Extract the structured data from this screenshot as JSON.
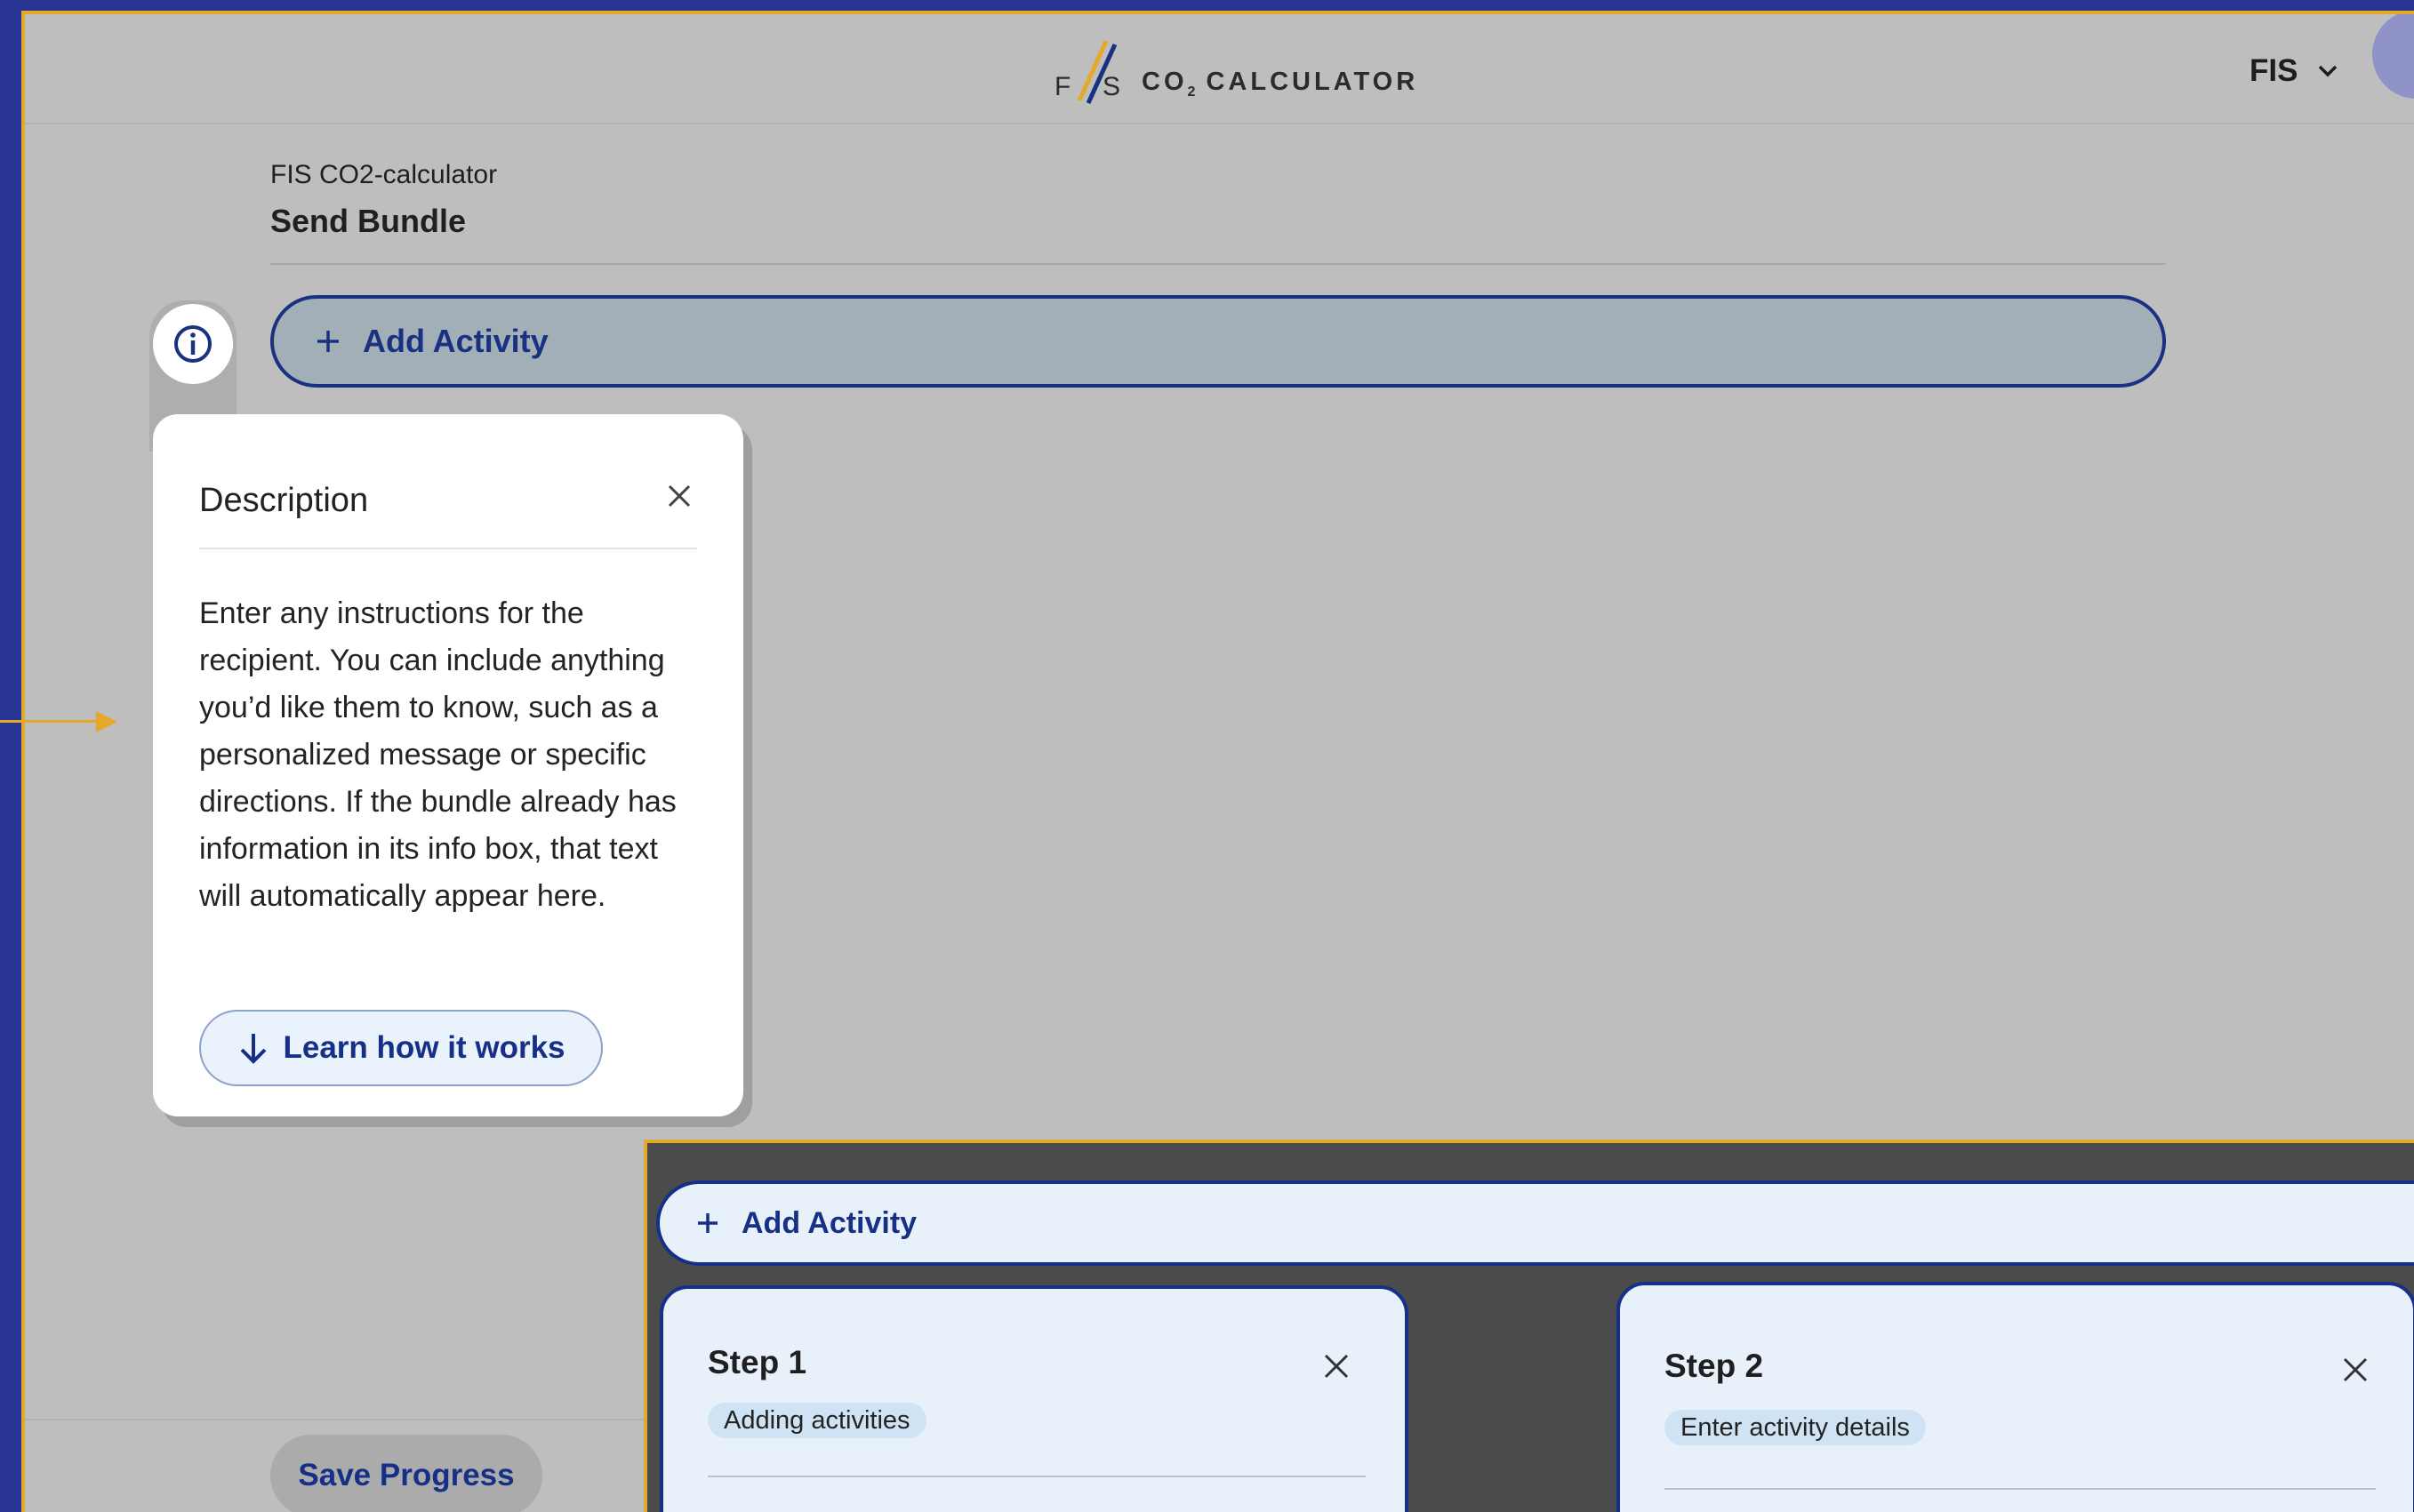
{
  "header": {
    "logo_text": "CO",
    "logo_sub": "2",
    "logo_suffix": " CALCULATOR",
    "org_menu": "FIS"
  },
  "breadcrumb": {
    "parent": "FIS CO2-calculator",
    "title": "Send Bundle"
  },
  "toolbar": {
    "add_activity_label": "Add Activity"
  },
  "description_popover": {
    "title": "Description",
    "body": "Enter any instructions for the recipient. You can include anything you’d like them to know, such as a personalized message or specific directions. If the bundle already has information in its info box, that text will automatically appear here.",
    "learn_label": "Learn how it works"
  },
  "footer": {
    "save_label": "Save Progress"
  },
  "inset": {
    "add_activity_label": "Add Activity",
    "steps": [
      {
        "title": "Step 1",
        "badge": "Adding activities"
      },
      {
        "title": "Step 2",
        "badge": "Enter activity details"
      }
    ]
  },
  "colors": {
    "brand_navy": "#183180",
    "accent_gold": "#e5a92a",
    "outer_blue": "#283593"
  },
  "icons": [
    "info-icon",
    "plus-icon",
    "close-icon",
    "arrow-down-icon",
    "chevron-down-icon"
  ]
}
